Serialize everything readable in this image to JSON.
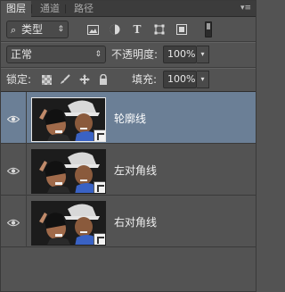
{
  "tabs": [
    {
      "label": "图层",
      "active": true
    },
    {
      "label": "通道",
      "active": false
    },
    {
      "label": "路径",
      "active": false
    }
  ],
  "filter": {
    "kind_label": "类型",
    "search_icon": "magnifier-icon"
  },
  "blend": {
    "mode": "正常",
    "opacity_label": "不透明度:",
    "opacity_value": "100%"
  },
  "lock": {
    "label": "锁定:",
    "fill_label": "填充:",
    "fill_value": "100%"
  },
  "layers": [
    {
      "name": "轮廓线",
      "selected": true
    },
    {
      "name": "左对角线",
      "selected": false
    },
    {
      "name": "右对角线",
      "selected": false
    }
  ],
  "colors": {
    "panel_bg": "#535353",
    "selected_layer": "#6b7f96",
    "tabbar_bg": "#3c3c3c"
  }
}
